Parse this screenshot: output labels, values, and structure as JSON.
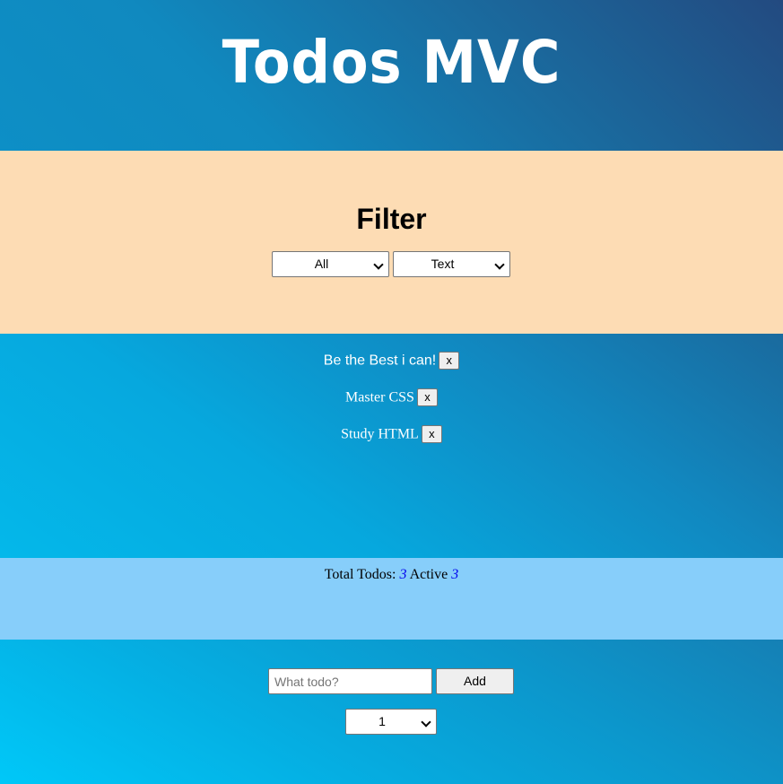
{
  "header": {
    "title": "Todos MVC"
  },
  "filter": {
    "heading": "Filter",
    "status_select": {
      "selected": "All"
    },
    "sort_select": {
      "selected": "Text"
    }
  },
  "todos": [
    {
      "text": "Be the Best i can!",
      "remove_label": "x"
    },
    {
      "text": "Master CSS",
      "remove_label": "x"
    },
    {
      "text": "Study HTML",
      "remove_label": "x"
    }
  ],
  "stats": {
    "total_label": "Total Todos:",
    "total_count": "3",
    "active_label": "Active",
    "active_count": "3"
  },
  "add_form": {
    "input_value": "",
    "input_placeholder": "What todo?",
    "add_label": "Add",
    "priority_select": {
      "selected": "1"
    }
  },
  "colors": {
    "filter_bg": "#fddcb4",
    "stats_bg": "#87cefa",
    "count_color": "#0000ee"
  }
}
